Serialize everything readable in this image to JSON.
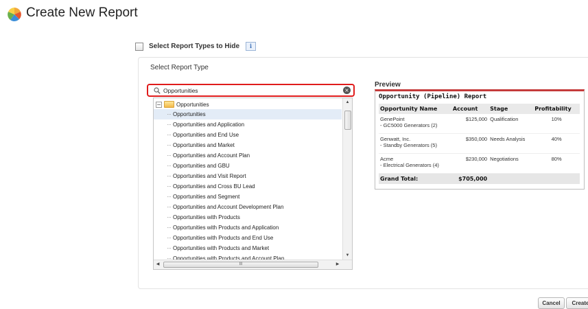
{
  "page": {
    "title": "Create New Report"
  },
  "hide_types": {
    "label": "Select Report Types to Hide",
    "info_icon": "info-icon"
  },
  "select": {
    "label": "Select Report Type"
  },
  "search": {
    "value": "Opportunities"
  },
  "tree": {
    "root": "Opportunities",
    "items": [
      "Opportunities",
      "Opportunities and Application",
      "Opportunities and End Use",
      "Opportunities and Market",
      "Opportunities and Account Plan",
      "Opportunities and GBU",
      "Opportunities and Visit Report",
      "Opportunities and Cross BU Lead",
      "Opportunities and Segment",
      "Opportunities and Account Development Plan",
      "Opportunities with Products",
      "Opportunities with Products and Application",
      "Opportunities with Products and End Use",
      "Opportunities with Products and Market",
      "Opportunities with Products and Account Plan"
    ],
    "hscroll_grip": "III"
  },
  "preview": {
    "label": "Preview",
    "report_title": "Opportunity (Pipeline) Report",
    "columns": [
      "Opportunity Name",
      "Account",
      "Stage",
      "Profitability"
    ],
    "rows": [
      {
        "name": "GenePoint",
        "sub": "- GC5000 Generators (2)",
        "account": "$125,000",
        "stage": "Qualification",
        "profit": "10%"
      },
      {
        "name": "Genwatt, Inc.",
        "sub": "- Standby Generators (5)",
        "account": "$350,000",
        "stage": "Needs Analysis",
        "profit": "40%"
      },
      {
        "name": "Acme",
        "sub": "- Electrical Generators (4)",
        "account": "$230,000",
        "stage": "Negotiations",
        "profit": "80%"
      }
    ],
    "total_label": "Grand Total:",
    "total_value": "$705,000"
  },
  "buttons": {
    "cancel": "Cancel",
    "create": "Create"
  }
}
